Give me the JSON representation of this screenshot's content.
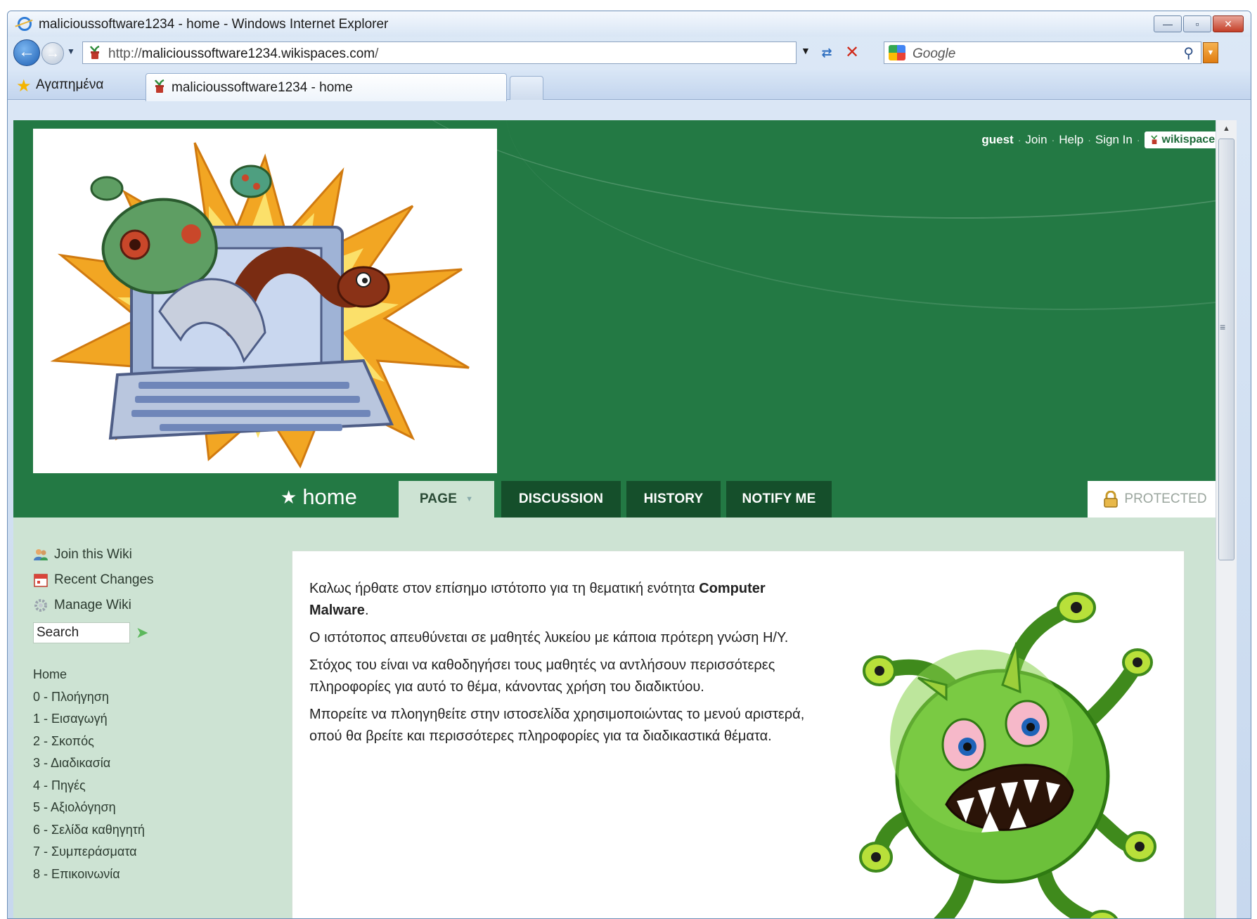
{
  "window": {
    "title": "malicioussoftware1234 - home - Windows Internet Explorer",
    "minimize": "—",
    "maximize": "▫",
    "close": "✕"
  },
  "navbar": {
    "url_prefix": "http://",
    "url_host": "malicioussoftware1234.wikispaces.com",
    "url_suffix": "/",
    "search_placeholder": "Google"
  },
  "tabs": {
    "favorites_label": "Αγαπημένα",
    "active_tab_label": "malicioussoftware1234 - home"
  },
  "userbar": {
    "user": "guest",
    "links": [
      "Join",
      "Help",
      "Sign In"
    ],
    "badge": "wikispaces"
  },
  "page": {
    "name": "home",
    "tabs": {
      "page": "PAGE",
      "discussion": "DISCUSSION",
      "history": "HISTORY",
      "notify": "NOTIFY ME"
    },
    "protected": "PROTECTED"
  },
  "sidebar": {
    "actions": [
      "Join this Wiki",
      "Recent Changes",
      "Manage Wiki"
    ],
    "search_value": "Search",
    "nav": [
      "Home",
      "0 - Πλοήγηση",
      "1 - Εισαγωγή",
      "2 - Σκοπός",
      "3 - Διαδικασία",
      "4 - Πηγές",
      "5 - Αξιολόγηση",
      "6 - Σελίδα καθηγητή",
      "7 - Συμπεράσματα",
      "8 - Επικοινωνία"
    ]
  },
  "content": {
    "p1_text": "Καλως ήρθατε στον επίσημο ιστότοπο για τη θεματική ενότητα ",
    "p1_bold": "Computer Malware",
    "p1_end": ".",
    "p2": "Ο ιστότοπος απευθύνεται σε μαθητές λυκείου με κάποια πρότερη γνώση Η/Υ.",
    "p3": "Στόχος του είναι να καθοδηγήσει τους μαθητές να αντλήσουν περισσότερες πληροφορίες για αυτό το θέμα, κάνοντας χρήση του διαδικτύου.",
    "p4": "Μπορείτε να πλοηγηθείτε στην ιστοσελίδα χρησιμοποιώντας το μενού αριστερά, οπού θα βρείτε και περισσότερες πληροφορίες για τα διαδικαστικά θέματα."
  },
  "colors": {
    "header_green": "#237944",
    "tab_dark_green": "#154f2b",
    "page_bg": "#cde3d3"
  }
}
